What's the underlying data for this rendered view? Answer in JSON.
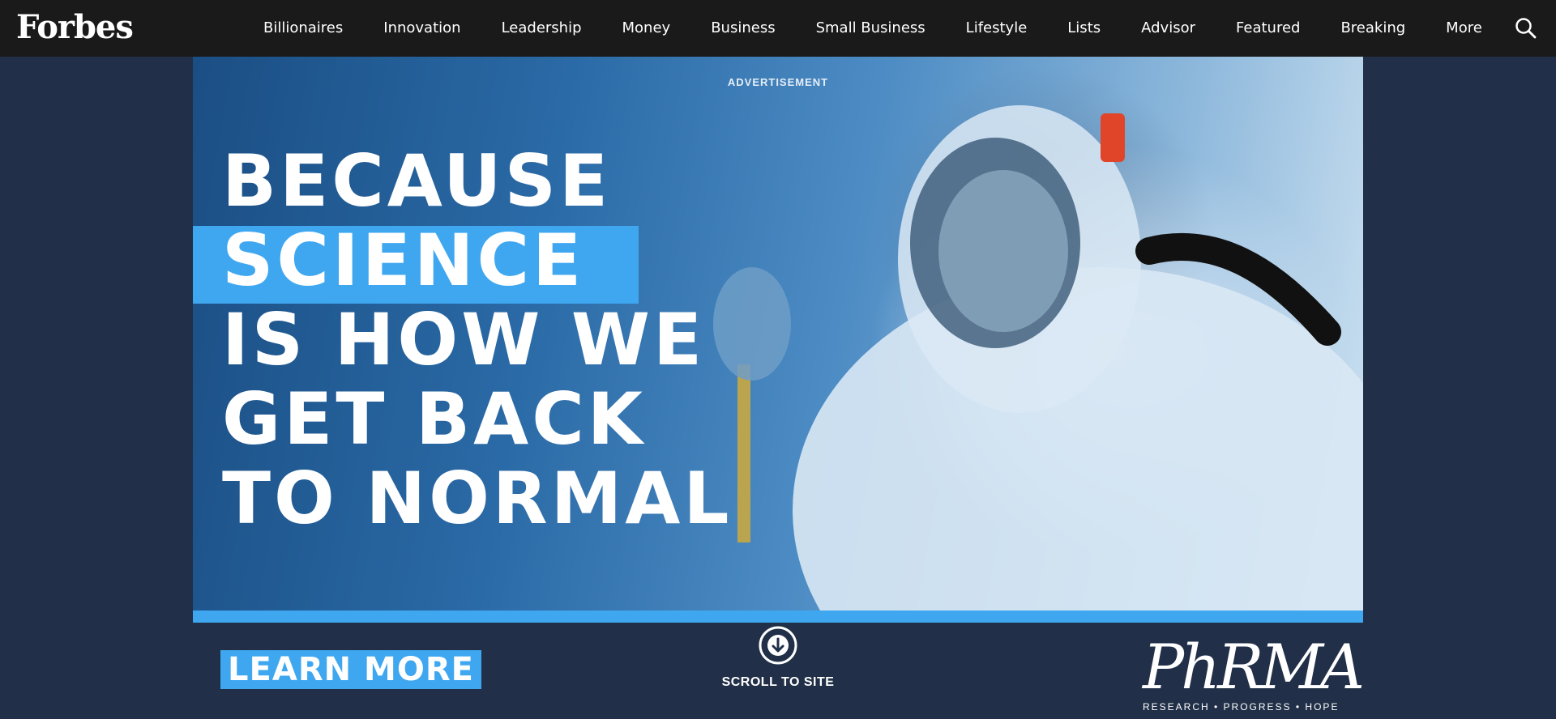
{
  "header": {
    "logo": "Forbes",
    "nav": [
      "Billionaires",
      "Innovation",
      "Leadership",
      "Money",
      "Business",
      "Small Business",
      "Lifestyle",
      "Lists",
      "Advisor",
      "Featured",
      "Breaking",
      "More"
    ],
    "search_icon": "search-icon"
  },
  "ad": {
    "label": "ADVERTISEMENT",
    "headline": [
      "BECAUSE",
      "SCIENCE",
      "IS HOW WE",
      "GET BACK",
      "TO NORMAL"
    ],
    "cta": "LEARN MORE",
    "scroll_label": "SCROLL TO SITE",
    "brand": "PhRMA",
    "brand_tagline": "RESEARCH • PROGRESS • HOPE",
    "accent_color": "#3fa7f0"
  },
  "colors": {
    "nav_bg": "#1a1a1a",
    "page_bg": "#213048"
  }
}
